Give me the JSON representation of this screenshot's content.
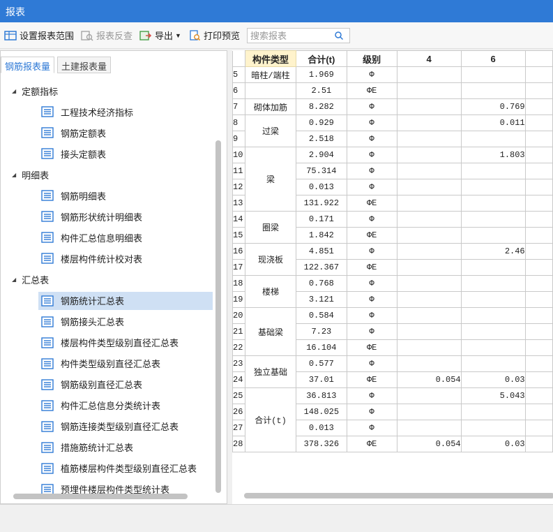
{
  "window": {
    "title": "报表"
  },
  "toolbar": {
    "set_range_label": "设置报表范围",
    "reverse_check_label": "报表反查",
    "export_label": "导出",
    "print_preview_label": "打印预览",
    "search_placeholder": "搜索报表"
  },
  "tabs": [
    {
      "label": "钢筋报表量",
      "active": true
    },
    {
      "label": "土建报表量",
      "active": false
    }
  ],
  "tree": {
    "groups": [
      {
        "label": "定额指标",
        "items": [
          "工程技术经济指标",
          "钢筋定额表",
          "接头定额表"
        ]
      },
      {
        "label": "明细表",
        "items": [
          "钢筋明细表",
          "钢筋形状统计明细表",
          "构件汇总信息明细表",
          "楼层构件统计校对表"
        ]
      },
      {
        "label": "汇总表",
        "items": [
          "钢筋统计汇总表",
          "钢筋接头汇总表",
          "楼层构件类型级别直径汇总表",
          "构件类型级别直径汇总表",
          "钢筋级别直径汇总表",
          "构件汇总信息分类统计表",
          "钢筋连接类型级别直径汇总表",
          "措施筋统计汇总表",
          "植筋楼层构件类型级别直径汇总表",
          "预埋件楼层构件类型统计表"
        ]
      }
    ],
    "selected": "钢筋统计汇总表"
  },
  "grid": {
    "headers": [
      "构件类型",
      "合计(t)",
      "级别",
      "4",
      "6"
    ],
    "rows": [
      {
        "n": "5",
        "cat": "暗柱/端柱",
        "span": 1,
        "total": "1.969",
        "grade": "Φ",
        "c4": "",
        "c6": ""
      },
      {
        "n": "6",
        "cat": "",
        "span": 1,
        "total": "2.51",
        "grade": "ΦE",
        "c4": "",
        "c6": ""
      },
      {
        "n": "7",
        "cat": "砌体加筋",
        "span": 1,
        "total": "8.282",
        "grade": "Φ",
        "c4": "",
        "c6": "0.769"
      },
      {
        "n": "8",
        "cat": "过梁",
        "span": 2,
        "total": "0.929",
        "grade": "Φ",
        "c4": "",
        "c6": "0.011"
      },
      {
        "n": "9",
        "cat": null,
        "span": 0,
        "total": "2.518",
        "grade": "Φ",
        "c4": "",
        "c6": ""
      },
      {
        "n": "10",
        "cat": "梁",
        "span": 4,
        "total": "2.904",
        "grade": "Φ",
        "c4": "",
        "c6": "1.803"
      },
      {
        "n": "11",
        "cat": null,
        "span": 0,
        "total": "75.314",
        "grade": "Φ",
        "c4": "",
        "c6": ""
      },
      {
        "n": "12",
        "cat": null,
        "span": 0,
        "total": "0.013",
        "grade": "Φ",
        "c4": "",
        "c6": ""
      },
      {
        "n": "13",
        "cat": null,
        "span": 0,
        "total": "131.922",
        "grade": "ΦE",
        "c4": "",
        "c6": ""
      },
      {
        "n": "14",
        "cat": "圈梁",
        "span": 2,
        "total": "0.171",
        "grade": "Φ",
        "c4": "",
        "c6": ""
      },
      {
        "n": "15",
        "cat": null,
        "span": 0,
        "total": "1.842",
        "grade": "ΦE",
        "c4": "",
        "c6": ""
      },
      {
        "n": "16",
        "cat": "现浇板",
        "span": 2,
        "total": "4.851",
        "grade": "Φ",
        "c4": "",
        "c6": "2.46"
      },
      {
        "n": "17",
        "cat": null,
        "span": 0,
        "total": "122.367",
        "grade": "ΦE",
        "c4": "",
        "c6": ""
      },
      {
        "n": "18",
        "cat": "楼梯",
        "span": 2,
        "total": "0.768",
        "grade": "Φ",
        "c4": "",
        "c6": ""
      },
      {
        "n": "19",
        "cat": null,
        "span": 0,
        "total": "3.121",
        "grade": "Φ",
        "c4": "",
        "c6": ""
      },
      {
        "n": "20",
        "cat": "基础梁",
        "span": 3,
        "total": "0.584",
        "grade": "Φ",
        "c4": "",
        "c6": ""
      },
      {
        "n": "21",
        "cat": null,
        "span": 0,
        "total": "7.23",
        "grade": "Φ",
        "c4": "",
        "c6": ""
      },
      {
        "n": "22",
        "cat": null,
        "span": 0,
        "total": "16.104",
        "grade": "ΦE",
        "c4": "",
        "c6": ""
      },
      {
        "n": "23",
        "cat": "独立基础",
        "span": 2,
        "total": "0.577",
        "grade": "Φ",
        "c4": "",
        "c6": ""
      },
      {
        "n": "24",
        "cat": null,
        "span": 0,
        "total": "37.01",
        "grade": "ΦE",
        "c4": "0.054",
        "c6": "0.03"
      },
      {
        "n": "25",
        "cat": "合计(t)",
        "span": 4,
        "total": "36.813",
        "grade": "Φ",
        "c4": "",
        "c6": "5.043"
      },
      {
        "n": "26",
        "cat": null,
        "span": 0,
        "total": "148.025",
        "grade": "Φ",
        "c4": "",
        "c6": ""
      },
      {
        "n": "27",
        "cat": null,
        "span": 0,
        "total": "0.013",
        "grade": "Φ",
        "c4": "",
        "c6": ""
      },
      {
        "n": "28",
        "cat": null,
        "span": 0,
        "total": "378.326",
        "grade": "ΦE",
        "c4": "0.054",
        "c6": "0.03"
      }
    ]
  },
  "colors": {
    "title_bar": "#2f7ad6",
    "selected_row": "#cfe0f4",
    "header_corner": "#fff3cc"
  }
}
